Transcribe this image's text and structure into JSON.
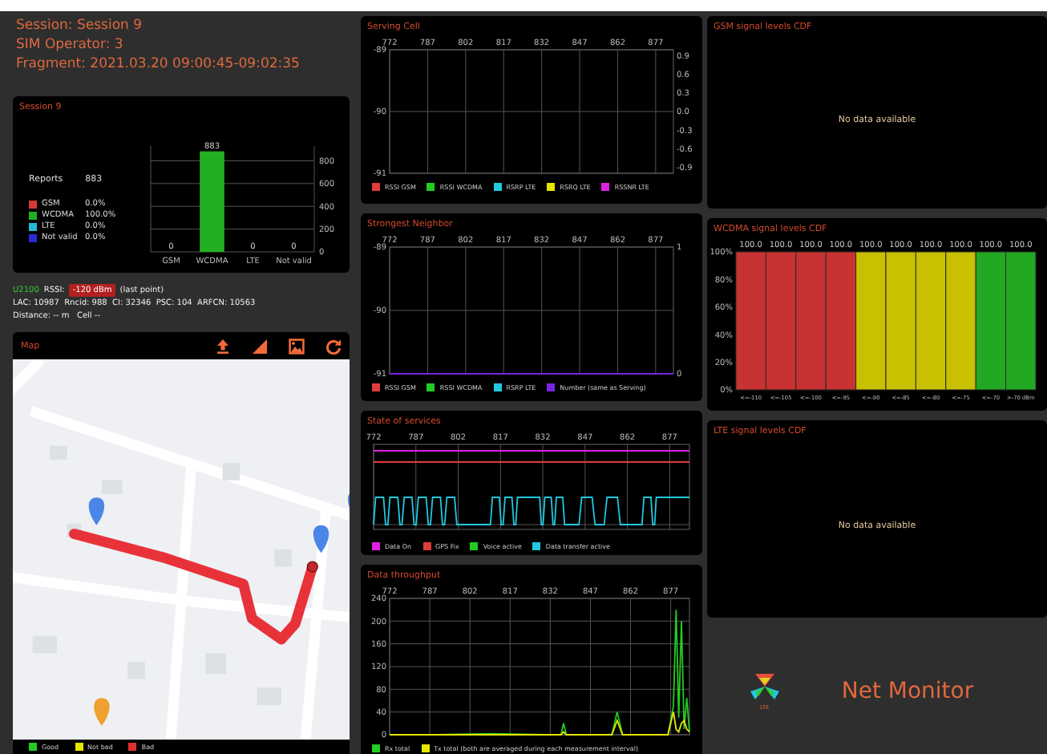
{
  "session_header": [
    "Session: Session 9",
    "SIM Operator: 3",
    "Fragment: 2021.03.20 09:00:45-09:02:35"
  ],
  "session_card": {
    "title": "Session 9",
    "reports_label": "Reports",
    "reports_value": "883",
    "stats": [
      {
        "label": "GSM",
        "value": "0.0%",
        "color": "#d43a3a"
      },
      {
        "label": "WCDMA",
        "value": "100.0%",
        "color": "#22b022"
      },
      {
        "label": "LTE",
        "value": "0.0%",
        "color": "#22b8d8"
      },
      {
        "label": "Not valid",
        "value": "0.0%",
        "color": "#2a2ad0"
      }
    ],
    "chart_data": {
      "type": "bar",
      "categories": [
        "GSM",
        "WCDMA",
        "LTE",
        "Not valid"
      ],
      "series": [
        {
          "color": "#22b022",
          "values": [
            0,
            883,
            0,
            0
          ]
        }
      ],
      "ylim": [
        0,
        930
      ],
      "yticks": [
        0,
        200,
        400,
        600,
        800
      ],
      "grid": true,
      "data_labels": true
    }
  },
  "cell_info": {
    "technology": "U2100",
    "rssi_label": "RSSI:",
    "rssi_value": "-120 dBm",
    "rssi_note": "(last point)",
    "identity": "LAC: 10987  Rncid: 988  CI: 32346  PSC: 104  ARFCN: 10563",
    "distance": "Distance: -- m   Cell --"
  },
  "map": {
    "title": "Map",
    "legend": [
      {
        "label": "Good",
        "color": "#22cc22"
      },
      {
        "label": "Not bad",
        "color": "#e6e600"
      },
      {
        "label": "Bad",
        "color": "#e03030"
      }
    ]
  },
  "charts": [
    {
      "title": "Serving Cell",
      "kind": "line",
      "right_axis_labels": [
        "0.9",
        "0.6",
        "0.3",
        "0.0",
        "-0.3",
        "-0.6",
        "-0.9"
      ],
      "chart_data": {
        "type": "line",
        "grid": true,
        "categories": [
          "772",
          "787",
          "802",
          "817",
          "832",
          "847",
          "862",
          "877"
        ],
        "ylim": [
          -91,
          -89
        ],
        "yticks": [
          -91,
          -90,
          -89
        ],
        "series": [
          {
            "name": "RSSI GSM",
            "color": "#e03c3c",
            "values": [
              null,
              null,
              null,
              null,
              null,
              null,
              null,
              null
            ]
          },
          {
            "name": "RSSI WCDMA",
            "color": "#22cc22",
            "values": [
              null,
              null,
              null,
              null,
              null,
              null,
              null,
              null
            ]
          },
          {
            "name": "RSRP LTE",
            "color": "#22c8e0",
            "values": [
              null,
              null,
              null,
              null,
              null,
              null,
              null,
              null
            ]
          },
          {
            "name": "RSRQ LTE",
            "color": "#e6e600",
            "values": [
              null,
              null,
              null,
              null,
              null,
              null,
              null,
              null
            ]
          },
          {
            "name": "RSSNR LTE",
            "color": "#e020e0",
            "values": [
              null,
              null,
              null,
              null,
              null,
              null,
              null,
              null
            ]
          }
        ]
      }
    },
    {
      "title": "Strongest Neighbor",
      "kind": "line",
      "right_axis_labels": [
        "1",
        "0"
      ],
      "chart_data": {
        "type": "line",
        "grid": true,
        "xlim": [
          772,
          884
        ],
        "xticks": [
          772,
          787,
          802,
          817,
          832,
          847,
          862,
          877
        ],
        "ylim": [
          -91,
          -89
        ],
        "yticks": [
          -91,
          -90,
          -89
        ],
        "x": [
          772,
          884
        ],
        "series": [
          {
            "name": "RSSI GSM",
            "color": "#e03c3c",
            "values": [
              null,
              null
            ]
          },
          {
            "name": "RSSI WCDMA",
            "color": "#22cc22",
            "values": [
              null,
              null
            ]
          },
          {
            "name": "RSRP LTE",
            "color": "#22c8e0",
            "values": [
              null,
              null
            ]
          },
          {
            "name": "Number (same as Serving)",
            "color": "#7a22e0",
            "values": [
              -91,
              -91
            ]
          }
        ]
      }
    },
    {
      "title": "State of services",
      "kind": "timeline",
      "x_labels": [
        "772",
        "787",
        "802",
        "817",
        "832",
        "847",
        "862",
        "877"
      ],
      "legend": [
        {
          "name": "Data On",
          "color": "#e020e0"
        },
        {
          "name": "GPS Fix",
          "color": "#e03c3c"
        },
        {
          "name": "Voice active",
          "color": "#22cc22"
        },
        {
          "name": "Data transfer active",
          "color": "#22c8e0"
        }
      ]
    },
    {
      "title": "Data throughput",
      "kind": "line",
      "chart_data": {
        "type": "line",
        "grid": true,
        "xlim": [
          772,
          884
        ],
        "xticks": [
          772,
          787,
          802,
          817,
          832,
          847,
          862,
          877
        ],
        "ylim": [
          0,
          240
        ],
        "yticks": [
          0,
          40,
          80,
          120,
          160,
          200,
          240
        ],
        "x": [
          772,
          790,
          810,
          830,
          836,
          837,
          838,
          850,
          855,
          857,
          859,
          870,
          876,
          878,
          879,
          880,
          881,
          882,
          883,
          884
        ],
        "series": [
          {
            "name": "Rx total",
            "color": "#22cc22",
            "values": [
              0,
              0,
              2,
              0,
              0,
              20,
              0,
              0,
              0,
              40,
              0,
              0,
              0,
              50,
              220,
              30,
              200,
              10,
              65,
              5
            ]
          },
          {
            "name": "Tx total (both are averaged during each measurement interval)",
            "color": "#e6e600",
            "values": [
              0,
              0,
              0,
              0,
              0,
              5,
              0,
              0,
              0,
              25,
              0,
              0,
              0,
              40,
              10,
              5,
              20,
              25,
              10,
              5
            ]
          }
        ]
      }
    }
  ],
  "cdf_panels": [
    {
      "title": "GSM signal levels CDF",
      "message": "No data available"
    },
    {
      "title": "WCDMA signal levels CDF",
      "chart_data": {
        "type": "bar",
        "stacked": true,
        "categories": [
          "<=-110",
          "<=-105",
          "<=-100",
          "<=-95",
          "<=-90",
          "<=-85",
          "<=-80",
          "<=-75",
          "<=-70",
          ">-70 dBm"
        ],
        "series": [
          {
            "color": "#c83232",
            "values": [
              100,
              100,
              100,
              100,
              null,
              null,
              null,
              null,
              null,
              null
            ]
          },
          {
            "color": "#c8c000",
            "values": [
              null,
              null,
              null,
              null,
              100,
              100,
              100,
              100,
              null,
              null
            ]
          },
          {
            "color": "#22a822",
            "values": [
              null,
              null,
              null,
              null,
              null,
              null,
              null,
              null,
              100,
              100
            ]
          }
        ],
        "ylim": [
          0,
          100
        ],
        "yticks": [
          {
            "value": 0,
            "label": "0%"
          },
          {
            "value": 20,
            "label": "20%"
          },
          {
            "value": 40,
            "label": "40%"
          },
          {
            "value": 60,
            "label": "60%"
          },
          {
            "value": 80,
            "label": "80%"
          },
          {
            "value": 100,
            "label": "100%"
          }
        ],
        "value_labels": [
          "100.0",
          "100.0",
          "100.0",
          "100.0",
          "100.0",
          "100.0",
          "100.0",
          "100.0",
          "100.0",
          "100.0"
        ]
      }
    },
    {
      "title": "LTE signal levels CDF",
      "message": "No data available"
    }
  ],
  "app": {
    "name": "Net Monitor",
    "badge": "LTE"
  }
}
